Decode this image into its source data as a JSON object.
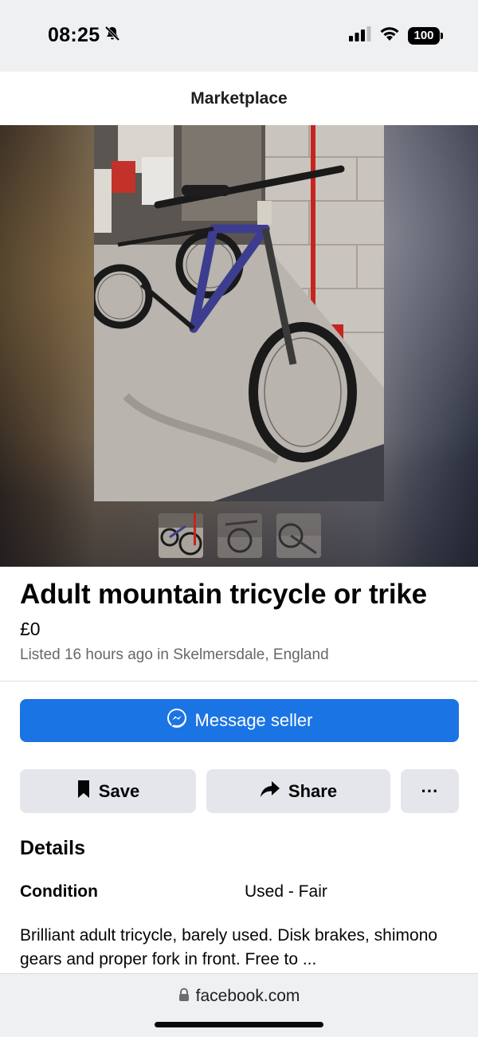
{
  "status_bar": {
    "time": "08:25",
    "battery": "100",
    "icons": [
      "bell-slash-icon",
      "signal-icon",
      "wifi-icon",
      "battery-icon"
    ]
  },
  "header": {
    "title": "Marketplace"
  },
  "photo": {
    "main_photo_alt": "bike-photo",
    "thumbnails": [
      "thumb-1",
      "thumb-2",
      "thumb-3"
    ]
  },
  "listing": {
    "title": "Adult mountain tricycle or trike",
    "price": "£0",
    "meta": "Listed 16 hours ago in Skelmersdale, England"
  },
  "actions": {
    "message_label": "Message seller",
    "save_label": "Save",
    "share_label": "Share",
    "more_label": "···"
  },
  "details": {
    "heading": "Details",
    "condition_label": "Condition",
    "condition_value": "Used - Fair",
    "description": "Brilliant adult tricycle, barely used. Disk brakes, shimono gears and proper fork in front. Free to ..."
  },
  "browser": {
    "url": "facebook.com"
  },
  "colors": {
    "accent": "#1b74e4",
    "button_gray": "#e4e6eb",
    "meta_gray": "#65676b",
    "bar_bg": "#eff0f2"
  }
}
